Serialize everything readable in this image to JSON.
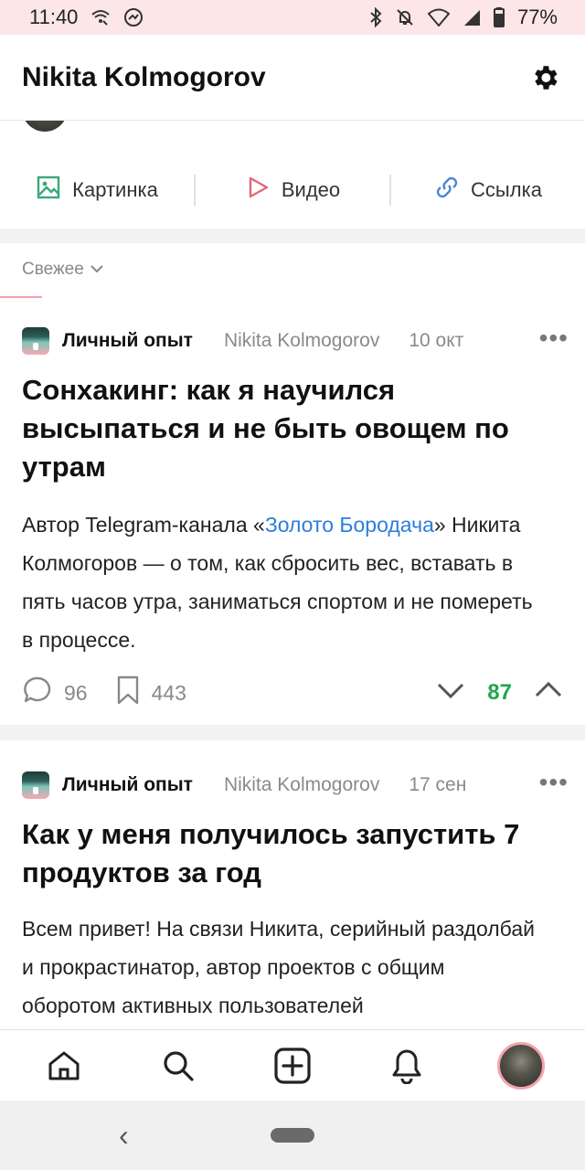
{
  "status_bar": {
    "time": "11:40",
    "battery": "77%",
    "icons_left": [
      "wifi-calling-icon",
      "messenger-icon"
    ],
    "icons_right": [
      "bluetooth-icon",
      "mute-icon",
      "wifi-icon",
      "signal-icon",
      "battery-icon"
    ]
  },
  "header": {
    "title": "Nikita Kolmogorov",
    "settings_icon": "gear-icon"
  },
  "media": {
    "picture_label": "Картинка",
    "video_label": "Видео",
    "link_label": "Ссылка",
    "colors": {
      "picture": "#3aa87a",
      "video": "#e06a7a",
      "link": "#4a86d8"
    }
  },
  "feed_filter": {
    "label": "Свежее"
  },
  "posts": [
    {
      "subsite": "Личный опыт",
      "author": "Nikita Kolmogorov",
      "date": "10 окт",
      "title": "Сонхакинг: как я научился высыпаться и не быть овощем по утрам",
      "text_before_link": "Автор Telegram-канала «",
      "link_text": "Золото Бородача",
      "text_after_link": "» Никита Колмогоров — о том, как сбросить вес, вставать в пять часов утра, заниматься спортом и не помереть в процессе.",
      "comments": "96",
      "bookmarks": "443",
      "rating": "87"
    },
    {
      "subsite": "Личный опыт",
      "author": "Nikita Kolmogorov",
      "date": "17 сен",
      "title": "Как у меня получилось запустить 7 продуктов за год",
      "text": "Всем привет! На связи Никита, серийный раздолбай и прокрастинатор, автор проектов с общим оборотом активных пользователей"
    }
  ],
  "bottom_nav": {
    "items": [
      "home-icon",
      "search-icon",
      "add-post-icon",
      "notifications-icon",
      "profile-avatar"
    ]
  },
  "accent_colors": {
    "positive": "#1fa74a",
    "link": "#2d7ddb",
    "pink": "#f4a3ae"
  }
}
